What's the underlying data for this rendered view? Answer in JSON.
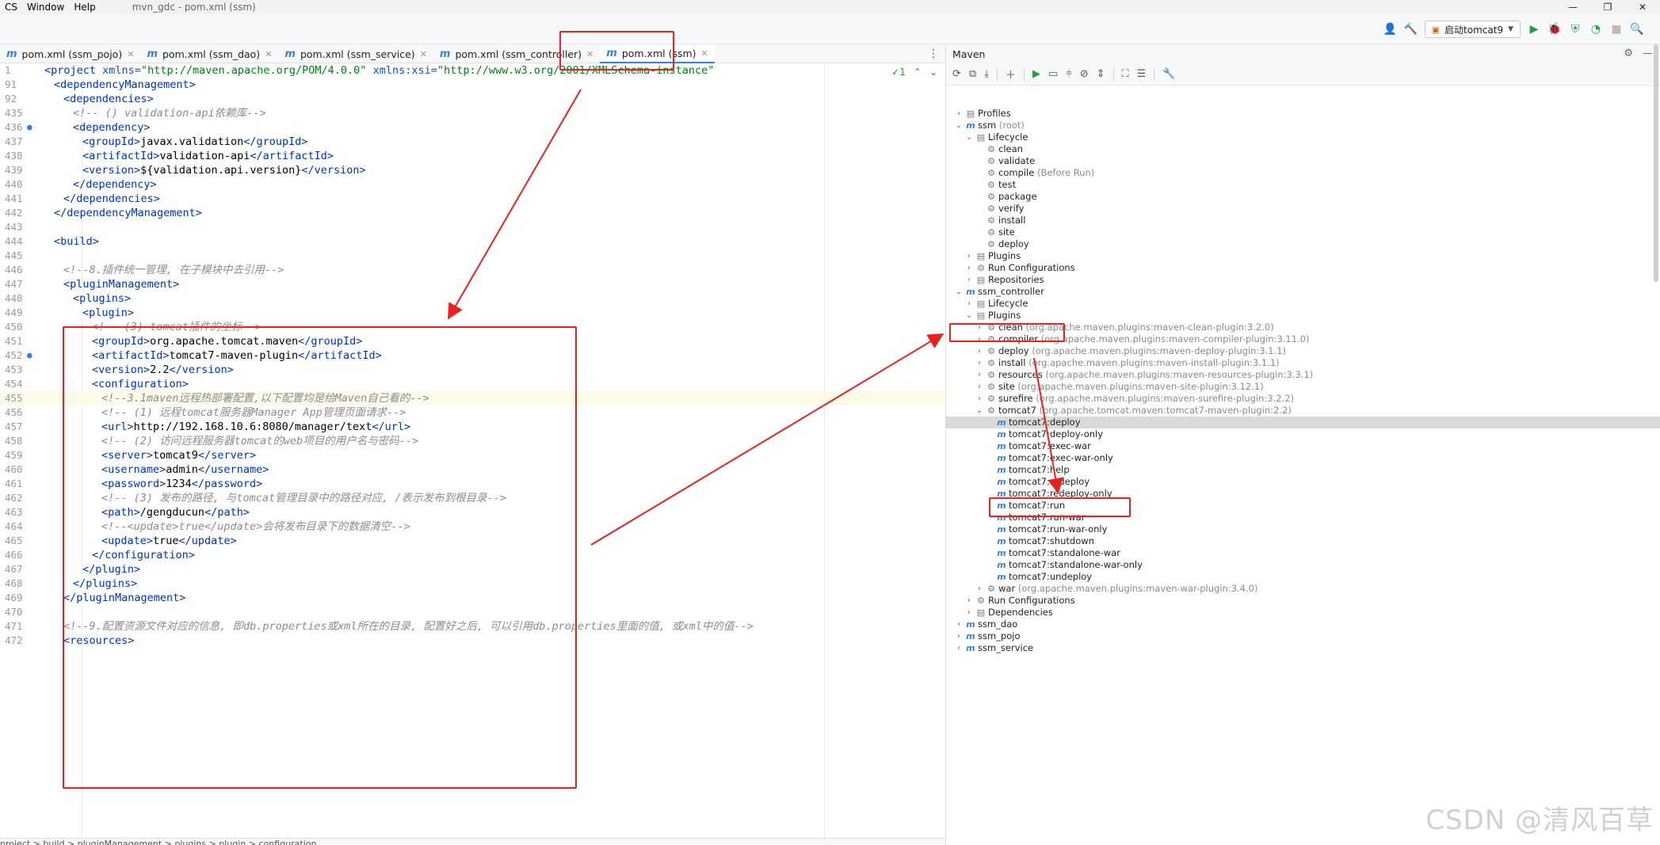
{
  "menu": {
    "items": [
      "CS",
      "Window",
      "Help"
    ],
    "title": "mvn_gdc - pom.xml (ssm)"
  },
  "toolbar": {
    "run_config": "启动tomcat9"
  },
  "tabs": [
    {
      "label": "pom.xml (ssm_pojo)",
      "active": false
    },
    {
      "label": "pom.xml (ssm_dao)",
      "active": false
    },
    {
      "label": "pom.xml (ssm_service)",
      "active": false
    },
    {
      "label": "pom.xml (ssm_controller)",
      "active": false
    },
    {
      "label": "pom.xml (ssm)",
      "active": true
    }
  ],
  "editor": {
    "inspection": "✓1",
    "lines": [
      {
        "n": "1",
        "html": "<span class='t-tag'>&lt;project</span> <span class='t-attr'>xmlns=</span><span class='t-str'>\"http://maven.apache.org/POM/4.0.0\"</span> <span class='t-attr'>xmlns:xsi=</span><span class='t-str'>\"http://www.w3.org/2001/XMLSchema-instance\"</span>",
        "indent": 0
      },
      {
        "n": "91",
        "html": "<span class='t-tag'>&lt;dependencyManagement&gt;</span>",
        "indent": 1
      },
      {
        "n": "92",
        "html": "<span class='t-tag'>&lt;dependencies&gt;</span>",
        "indent": 2
      },
      {
        "n": "435",
        "html": "<span class='t-cmt'>&lt;!-- () validation-api依赖库--&gt;</span>",
        "indent": 3
      },
      {
        "n": "436",
        "html": "<span class='t-tag'>&lt;dependency&gt;</span>",
        "indent": 3,
        "mark": true
      },
      {
        "n": "437",
        "html": "<span class='t-tag'>&lt;groupId&gt;</span>javax.validation<span class='t-tag'>&lt;/groupId&gt;</span>",
        "indent": 4
      },
      {
        "n": "438",
        "html": "<span class='t-tag'>&lt;artifactId&gt;</span>validation-api<span class='t-tag'>&lt;/artifactId&gt;</span>",
        "indent": 4
      },
      {
        "n": "439",
        "html": "<span class='t-tag'>&lt;version&gt;</span>${validation.api.version}<span class='t-tag'>&lt;/version&gt;</span>",
        "indent": 4
      },
      {
        "n": "440",
        "html": "<span class='t-tag'>&lt;/dependency&gt;</span>",
        "indent": 3
      },
      {
        "n": "441",
        "html": "<span class='t-tag'>&lt;/dependencies&gt;</span>",
        "indent": 2
      },
      {
        "n": "442",
        "html": "<span class='t-tag'>&lt;/dependencyManagement&gt;</span>",
        "indent": 1
      },
      {
        "n": "443",
        "html": "",
        "indent": 0
      },
      {
        "n": "444",
        "html": "<span class='t-tag'>&lt;build&gt;</span>",
        "indent": 1
      },
      {
        "n": "445",
        "html": "",
        "indent": 0
      },
      {
        "n": "446",
        "html": "<span class='t-cmt'>&lt;!--8.插件统一管理, 在子模块中去引用--&gt;</span>",
        "indent": 2
      },
      {
        "n": "447",
        "html": "<span class='t-tag'>&lt;pluginManagement&gt;</span>",
        "indent": 2
      },
      {
        "n": "448",
        "html": "<span class='t-tag'>&lt;plugins&gt;</span>",
        "indent": 3
      },
      {
        "n": "449",
        "html": "<span class='t-tag'>&lt;plugin&gt;</span>",
        "indent": 4
      },
      {
        "n": "450",
        "html": "<span class='t-cmt'>&lt;!-- (3) tomcat插件的坐标--&gt;</span>",
        "indent": 5
      },
      {
        "n": "451",
        "html": "<span class='t-tag'>&lt;groupId&gt;</span>org.apache.tomcat.maven<span class='t-tag'>&lt;/groupId&gt;</span>",
        "indent": 5
      },
      {
        "n": "452",
        "html": "<span class='t-tag'>&lt;artifactId&gt;</span>tomcat7-maven-plugin<span class='t-tag'>&lt;/artifactId&gt;</span>",
        "indent": 5,
        "mark": true
      },
      {
        "n": "453",
        "html": "<span class='t-tag'>&lt;version&gt;</span>2.2<span class='t-tag'>&lt;/version&gt;</span>",
        "indent": 5
      },
      {
        "n": "454",
        "html": "<span class='t-tag'>&lt;configuration&gt;</span>",
        "indent": 5
      },
      {
        "n": "455",
        "html": "<span class='t-cmt'>&lt;!--3.1maven远程热部署配置,以下配置均是给Maven自己看的--&gt;</span>",
        "indent": 6,
        "hl": true
      },
      {
        "n": "456",
        "html": "<span class='t-cmt'>&lt;!-- (1) 远程tomcat服务器Manager App管理页面请求--&gt;</span>",
        "indent": 6
      },
      {
        "n": "457",
        "html": "<span class='t-tag'>&lt;url&gt;</span>http://192.168.10.6:8080/manager/text<span class='t-tag'>&lt;/url&gt;</span>",
        "indent": 6
      },
      {
        "n": "458",
        "html": "<span class='t-cmt'>&lt;!-- (2) 访问远程服务器tomcat的web项目的用户名与密码--&gt;</span>",
        "indent": 6
      },
      {
        "n": "459",
        "html": "<span class='t-tag'>&lt;server&gt;</span>tomcat9<span class='t-tag'>&lt;/server&gt;</span>",
        "indent": 6
      },
      {
        "n": "460",
        "html": "<span class='t-tag'>&lt;username&gt;</span>admin<span class='t-tag'>&lt;/username&gt;</span>",
        "indent": 6
      },
      {
        "n": "461",
        "html": "<span class='t-tag'>&lt;password&gt;</span>1234<span class='t-tag'>&lt;/password&gt;</span>",
        "indent": 6
      },
      {
        "n": "462",
        "html": "<span class='t-cmt'>&lt;!-- (3) 发布的路径, 与tomcat管理目录中的路径对应, /表示发布到根目录--&gt;</span>",
        "indent": 6
      },
      {
        "n": "463",
        "html": "<span class='t-tag'>&lt;path&gt;</span>/gengducun<span class='t-tag'>&lt;/path&gt;</span>",
        "indent": 6
      },
      {
        "n": "464",
        "html": "<span class='t-cmt'>&lt;!--&lt;update&gt;true&lt;/update&gt;会将发布目录下的数据清空--&gt;</span>",
        "indent": 6
      },
      {
        "n": "465",
        "html": "<span class='t-tag'>&lt;update&gt;</span>true<span class='t-tag'>&lt;/update&gt;</span>",
        "indent": 6
      },
      {
        "n": "466",
        "html": "<span class='t-tag'>&lt;/configuration&gt;</span>",
        "indent": 5
      },
      {
        "n": "467",
        "html": "<span class='t-tag'>&lt;/plugin&gt;</span>",
        "indent": 4
      },
      {
        "n": "468",
        "html": "<span class='t-tag'>&lt;/plugins&gt;</span>",
        "indent": 3
      },
      {
        "n": "469",
        "html": "<span class='t-tag'>&lt;/pluginManagement&gt;</span>",
        "indent": 2
      },
      {
        "n": "470",
        "html": "",
        "indent": 0
      },
      {
        "n": "471",
        "html": "<span class='t-cmt'>&lt;!--9.配置资源文件对应的信息, 即db.properties或xml所在的目录, 配置好之后, 可以引用db.properties里面的值, 或xml中的值--&gt;</span>",
        "indent": 2
      },
      {
        "n": "472",
        "html": "<span class='t-tag'>&lt;resources&gt;</span>",
        "indent": 2
      }
    ]
  },
  "breadcrumb": "project  >  build  >  pluginManagement  >  plugins  >  plugin  >  configuration",
  "maven": {
    "title": "Maven",
    "tree": [
      {
        "depth": 0,
        "arrow": "›",
        "icon": "▤",
        "label": "Profiles",
        "dim": ""
      },
      {
        "depth": 0,
        "arrow": "⌄",
        "icon": "m",
        "label": "ssm",
        "dim": " (root)"
      },
      {
        "depth": 1,
        "arrow": "⌄",
        "icon": "▤",
        "label": "Lifecycle",
        "dim": ""
      },
      {
        "depth": 2,
        "arrow": "",
        "icon": "⚙",
        "label": "clean",
        "dim": ""
      },
      {
        "depth": 2,
        "arrow": "",
        "icon": "⚙",
        "label": "validate",
        "dim": ""
      },
      {
        "depth": 2,
        "arrow": "",
        "icon": "⚙",
        "label": "compile",
        "dim": " (Before Run)"
      },
      {
        "depth": 2,
        "arrow": "",
        "icon": "⚙",
        "label": "test",
        "dim": ""
      },
      {
        "depth": 2,
        "arrow": "",
        "icon": "⚙",
        "label": "package",
        "dim": ""
      },
      {
        "depth": 2,
        "arrow": "",
        "icon": "⚙",
        "label": "verify",
        "dim": ""
      },
      {
        "depth": 2,
        "arrow": "",
        "icon": "⚙",
        "label": "install",
        "dim": ""
      },
      {
        "depth": 2,
        "arrow": "",
        "icon": "⚙",
        "label": "site",
        "dim": ""
      },
      {
        "depth": 2,
        "arrow": "",
        "icon": "⚙",
        "label": "deploy",
        "dim": ""
      },
      {
        "depth": 1,
        "arrow": "›",
        "icon": "▤",
        "label": "Plugins",
        "dim": ""
      },
      {
        "depth": 1,
        "arrow": "›",
        "icon": "⚙",
        "label": "Run Configurations",
        "dim": ""
      },
      {
        "depth": 1,
        "arrow": "›",
        "icon": "▤",
        "label": "Repositories",
        "dim": ""
      },
      {
        "depth": 0,
        "arrow": "⌄",
        "icon": "m",
        "label": "ssm_controller",
        "dim": ""
      },
      {
        "depth": 1,
        "arrow": "›",
        "icon": "▤",
        "label": "Lifecycle",
        "dim": ""
      },
      {
        "depth": 1,
        "arrow": "⌄",
        "icon": "▤",
        "label": "Plugins",
        "dim": ""
      },
      {
        "depth": 2,
        "arrow": "›",
        "icon": "⚙",
        "label": "clean",
        "dim": " (org.apache.maven.plugins:maven-clean-plugin:3.2.0)"
      },
      {
        "depth": 2,
        "arrow": "›",
        "icon": "⚙",
        "label": "compiler",
        "dim": " (org.apache.maven.plugins:maven-compiler-plugin:3.11.0)"
      },
      {
        "depth": 2,
        "arrow": "›",
        "icon": "⚙",
        "label": "deploy",
        "dim": " (org.apache.maven.plugins:maven-deploy-plugin:3.1.1)"
      },
      {
        "depth": 2,
        "arrow": "›",
        "icon": "⚙",
        "label": "install",
        "dim": " (org.apache.maven.plugins:maven-install-plugin:3.1.1)"
      },
      {
        "depth": 2,
        "arrow": "›",
        "icon": "⚙",
        "label": "resources",
        "dim": " (org.apache.maven.plugins:maven-resources-plugin:3.3.1)"
      },
      {
        "depth": 2,
        "arrow": "›",
        "icon": "⚙",
        "label": "site",
        "dim": " (org.apache.maven.plugins:maven-site-plugin:3.12.1)"
      },
      {
        "depth": 2,
        "arrow": "›",
        "icon": "⚙",
        "label": "surefire",
        "dim": " (org.apache.maven.plugins:maven-surefire-plugin:3.2.2)"
      },
      {
        "depth": 2,
        "arrow": "⌄",
        "icon": "⚙",
        "label": "tomcat7",
        "dim": " (org.apache.tomcat.maven:tomcat7-maven-plugin:2.2)"
      },
      {
        "depth": 3,
        "arrow": "",
        "icon": "m",
        "label": "tomcat7:deploy",
        "dim": "",
        "sel": true
      },
      {
        "depth": 3,
        "arrow": "",
        "icon": "m",
        "label": "tomcat7:deploy-only",
        "dim": ""
      },
      {
        "depth": 3,
        "arrow": "",
        "icon": "m",
        "label": "tomcat7:exec-war",
        "dim": ""
      },
      {
        "depth": 3,
        "arrow": "",
        "icon": "m",
        "label": "tomcat7:exec-war-only",
        "dim": ""
      },
      {
        "depth": 3,
        "arrow": "",
        "icon": "m",
        "label": "tomcat7:help",
        "dim": ""
      },
      {
        "depth": 3,
        "arrow": "",
        "icon": "m",
        "label": "tomcat7:redeploy",
        "dim": ""
      },
      {
        "depth": 3,
        "arrow": "",
        "icon": "m",
        "label": "tomcat7:redeploy-only",
        "dim": ""
      },
      {
        "depth": 3,
        "arrow": "",
        "icon": "m",
        "label": "tomcat7:run",
        "dim": ""
      },
      {
        "depth": 3,
        "arrow": "",
        "icon": "m",
        "label": "tomcat7:run-war",
        "dim": ""
      },
      {
        "depth": 3,
        "arrow": "",
        "icon": "m",
        "label": "tomcat7:run-war-only",
        "dim": ""
      },
      {
        "depth": 3,
        "arrow": "",
        "icon": "m",
        "label": "tomcat7:shutdown",
        "dim": ""
      },
      {
        "depth": 3,
        "arrow": "",
        "icon": "m",
        "label": "tomcat7:standalone-war",
        "dim": ""
      },
      {
        "depth": 3,
        "arrow": "",
        "icon": "m",
        "label": "tomcat7:standalone-war-only",
        "dim": ""
      },
      {
        "depth": 3,
        "arrow": "",
        "icon": "m",
        "label": "tomcat7:undeploy",
        "dim": ""
      },
      {
        "depth": 2,
        "arrow": "›",
        "icon": "⚙",
        "label": "war",
        "dim": " (org.apache.maven.plugins:maven-war-plugin:3.4.0)"
      },
      {
        "depth": 1,
        "arrow": "›",
        "icon": "⚙",
        "label": "Run Configurations",
        "dim": ""
      },
      {
        "depth": 1,
        "arrow": "›",
        "icon": "▤",
        "label": "Dependencies",
        "dim": ""
      },
      {
        "depth": 0,
        "arrow": "›",
        "icon": "m",
        "label": "ssm_dao",
        "dim": ""
      },
      {
        "depth": 0,
        "arrow": "›",
        "icon": "m",
        "label": "ssm_pojo",
        "dim": ""
      },
      {
        "depth": 0,
        "arrow": "›",
        "icon": "m",
        "label": "ssm_service",
        "dim": ""
      }
    ]
  },
  "watermark": "CSDN @清风百草",
  "colors": {
    "annotation": "#e8221f",
    "accent": "#3b7fd4"
  }
}
